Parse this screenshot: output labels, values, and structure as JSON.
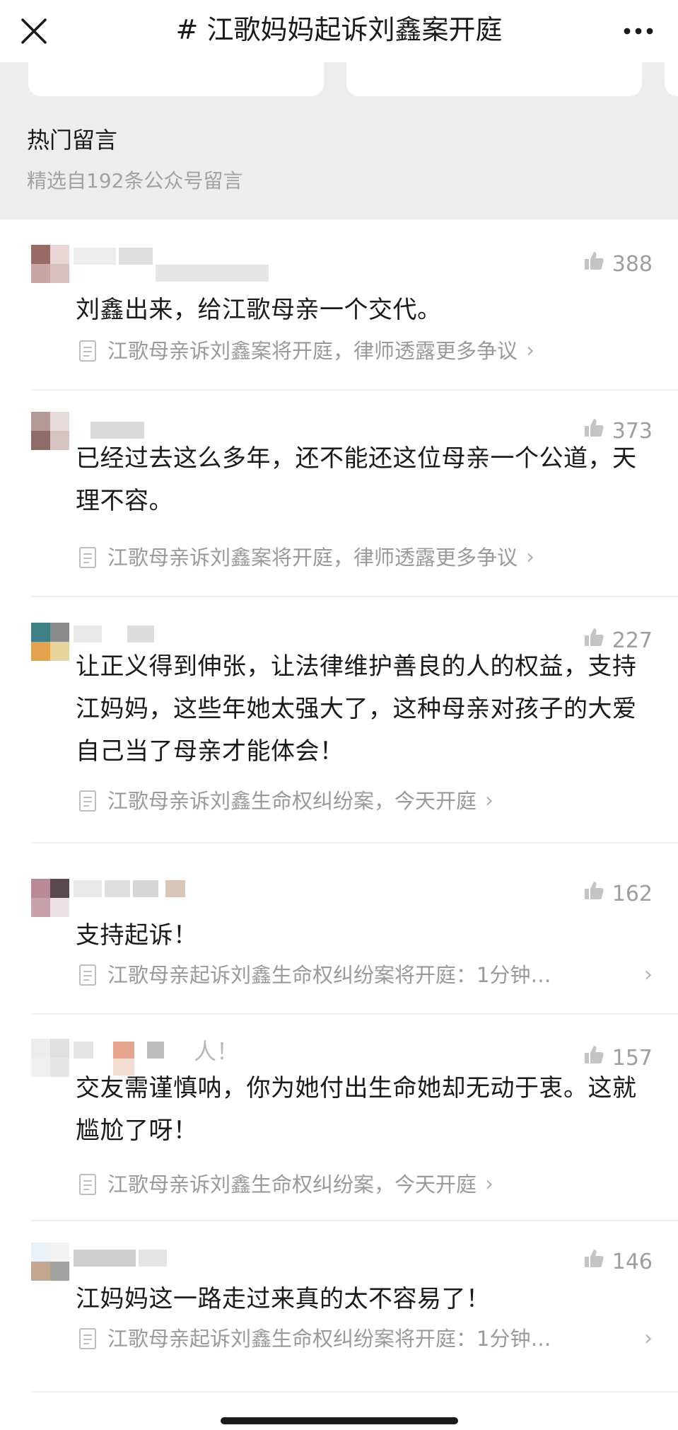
{
  "header": {
    "title": "# 江歌妈妈起诉刘鑫案开庭"
  },
  "section": {
    "title": "热门留言",
    "subtitle": "精选自192条公众号留言"
  },
  "comments": [
    {
      "likes": "388",
      "text": "刘鑫出来，给江歌母亲一个交代。",
      "source": "江歌母亲诉刘鑫案将开庭，律师透露更多争议"
    },
    {
      "likes": "373",
      "text": "已经过去这么多年，还不能还这位母亲一个公道，天理不容。",
      "source": "江歌母亲诉刘鑫案将开庭，律师透露更多争议"
    },
    {
      "likes": "227",
      "text": "让正义得到伸张，让法律维护善良的人的权益，支持江妈妈，这些年她太强大了，这种母亲对孩子的大爱自己当了母亲才能体会！",
      "source": "江歌母亲诉刘鑫生命权纠纷案，今天开庭"
    },
    {
      "likes": "162",
      "text": "支持起诉！",
      "source": "江歌母亲起诉刘鑫生命权纠纷案将开庭：1分钟…"
    },
    {
      "likes": "157",
      "nick_tail": "人！",
      "text": "交友需谨慎呐，你为她付出生命她却无动于衷。这就尴尬了呀！",
      "source": "江歌母亲诉刘鑫生命权纠纷案，今天开庭"
    },
    {
      "likes": "146",
      "text": "江妈妈这一路走过来真的太不容易了！",
      "source": "江歌母亲起诉刘鑫生命权纠纷案将开庭：1分钟…"
    }
  ]
}
